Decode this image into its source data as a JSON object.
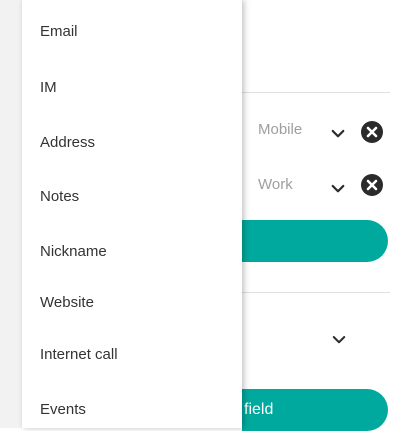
{
  "menu": {
    "items": [
      {
        "label": "Email"
      },
      {
        "label": "IM"
      },
      {
        "label": "Address"
      },
      {
        "label": "Notes"
      },
      {
        "label": "Nickname"
      },
      {
        "label": "Website"
      },
      {
        "label": "Internet call"
      },
      {
        "label": "Events"
      }
    ]
  },
  "background": {
    "phone_rows": [
      {
        "type": "Mobile"
      },
      {
        "type": "Work"
      }
    ],
    "add_field_partial": "field",
    "colors": {
      "accent": "#00a99d",
      "close": "#2b2b2b",
      "label": "#9e9e9e"
    }
  }
}
